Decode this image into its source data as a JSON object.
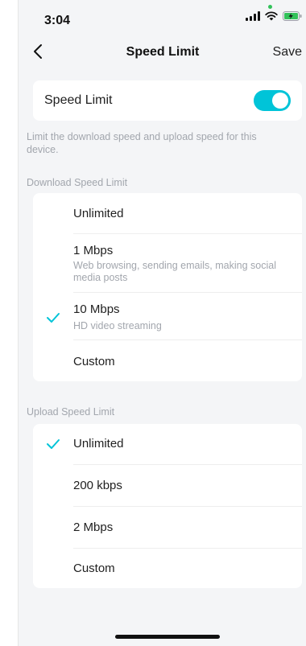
{
  "status_bar": {
    "time": "3:04"
  },
  "nav": {
    "title": "Speed Limit",
    "save_label": "Save"
  },
  "toggle": {
    "label": "Speed Limit",
    "enabled": true
  },
  "description": "Limit the download speed and upload speed for this device.",
  "download": {
    "header": "Download Speed Limit",
    "options": [
      {
        "label": "Unlimited",
        "sub": "",
        "selected": false
      },
      {
        "label": "1 Mbps",
        "sub": "Web browsing, sending emails, making social media posts",
        "selected": false
      },
      {
        "label": "10 Mbps",
        "sub": "HD video streaming",
        "selected": true
      },
      {
        "label": "Custom",
        "sub": "",
        "selected": false
      }
    ]
  },
  "upload": {
    "header": "Upload Speed Limit",
    "options": [
      {
        "label": "Unlimited",
        "selected": true
      },
      {
        "label": "200 kbps",
        "selected": false
      },
      {
        "label": "2 Mbps",
        "selected": false
      },
      {
        "label": "Custom",
        "selected": false
      }
    ]
  },
  "colors": {
    "accent": "#00c4d8",
    "background": "#f4f5f7",
    "muted_text": "#a2a6ad"
  }
}
